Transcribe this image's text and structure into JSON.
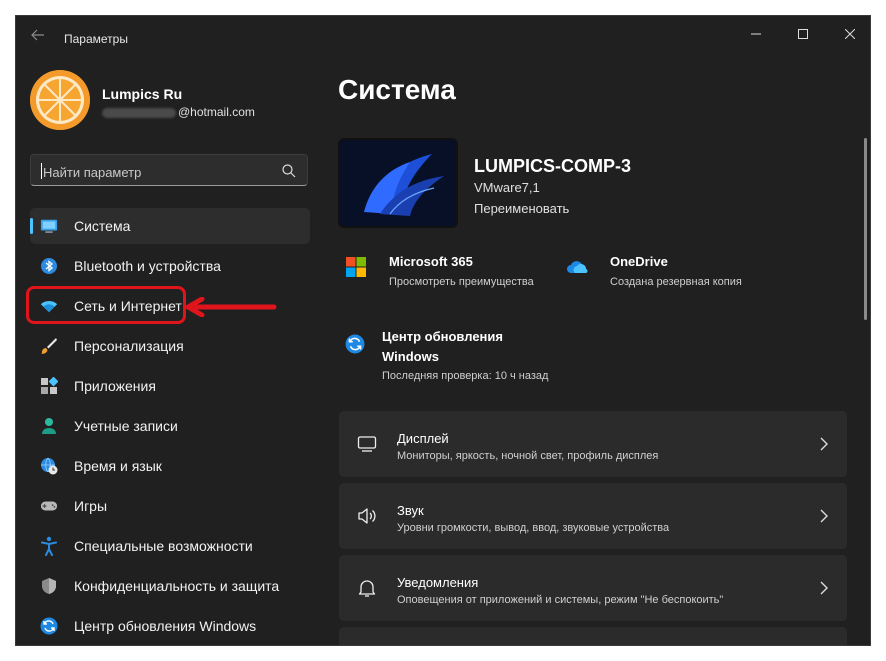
{
  "window": {
    "title": "Параметры"
  },
  "profile": {
    "name": "Lumpics Ru",
    "email_suffix": "@hotmail.com"
  },
  "search": {
    "placeholder": "Найти параметр"
  },
  "sidebar": {
    "items": [
      {
        "label": "Система",
        "icon": "system-icon",
        "selected": true
      },
      {
        "label": "Bluetooth и устройства",
        "icon": "bluetooth-icon"
      },
      {
        "label": "Сеть и Интернет",
        "icon": "wifi-icon",
        "highlighted": true
      },
      {
        "label": "Персонализация",
        "icon": "brush-icon"
      },
      {
        "label": "Приложения",
        "icon": "apps-icon"
      },
      {
        "label": "Учетные записи",
        "icon": "account-icon"
      },
      {
        "label": "Время и язык",
        "icon": "globe-clock-icon"
      },
      {
        "label": "Игры",
        "icon": "gamepad-icon"
      },
      {
        "label": "Специальные возможности",
        "icon": "accessibility-icon"
      },
      {
        "label": "Конфиденциальность и защита",
        "icon": "shield-icon"
      },
      {
        "label": "Центр обновления Windows",
        "icon": "update-icon"
      }
    ]
  },
  "main": {
    "title": "Система",
    "device": {
      "name": "LUMPICS-COMP-3",
      "model": "VMware7,1",
      "rename": "Переименовать"
    },
    "tiles": [
      {
        "title": "Microsoft 365",
        "subtitle": "Просмотреть преимущества",
        "icon": "microsoft-icon"
      },
      {
        "title": "OneDrive",
        "subtitle": "Создана резервная копия",
        "icon": "cloud-icon"
      }
    ],
    "update": {
      "title": "Центр обновления Windows",
      "subtitle": "Последняя проверка: 10 ч назад"
    },
    "cards": [
      {
        "title": "Дисплей",
        "subtitle": "Мониторы, яркость, ночной свет, профиль дисплея",
        "icon": "monitor-icon"
      },
      {
        "title": "Звук",
        "subtitle": "Уровни громкости, вывод, ввод, звуковые устройства",
        "icon": "speaker-icon"
      },
      {
        "title": "Уведомления",
        "subtitle": "Оповещения от приложений и системы, режим \"Не беспокоить\"",
        "icon": "bell-icon"
      }
    ]
  },
  "colors": {
    "accent": "#4cc2ff",
    "background": "#202020",
    "card": "#2b2b2b",
    "annotation": "#e0141b"
  }
}
